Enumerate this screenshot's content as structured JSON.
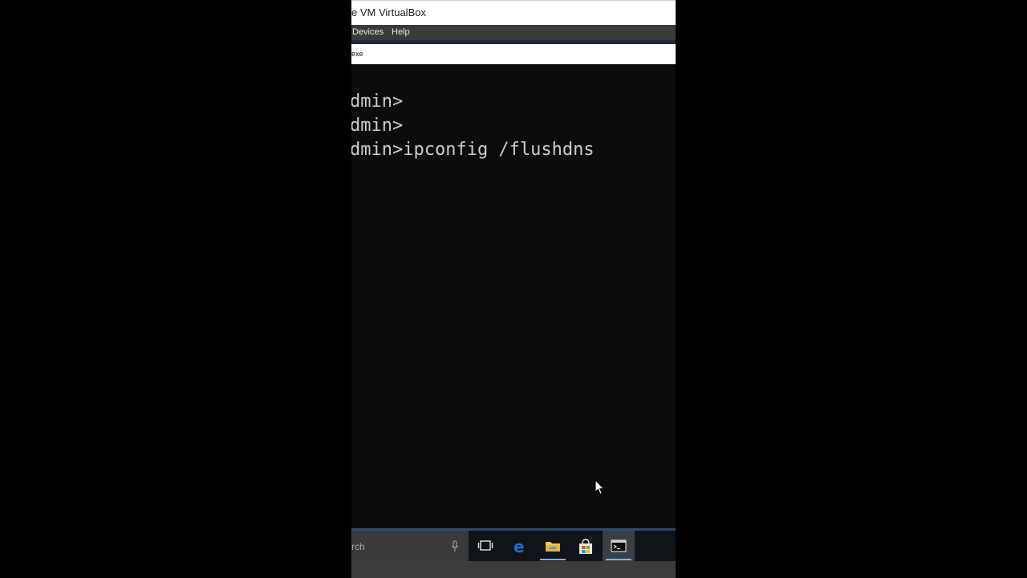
{
  "vbox": {
    "title": "e VM VirtualBox",
    "menu": [
      {
        "label": "Devices"
      },
      {
        "label": "Help"
      }
    ]
  },
  "cmd": {
    "title": "exe"
  },
  "console": {
    "lines": [
      "dmin>",
      "dmin>",
      "dmin>ipconfig /flushdns"
    ]
  },
  "taskbar": {
    "search_text": "rch",
    "icons": [
      {
        "name": "microphone-icon"
      },
      {
        "name": "task-view-icon"
      },
      {
        "name": "edge-icon"
      },
      {
        "name": "file-explorer-icon"
      },
      {
        "name": "store-icon"
      },
      {
        "name": "command-prompt-icon"
      }
    ]
  },
  "colors": {
    "console_bg": "#0c0c0c",
    "console_text": "#cccccc",
    "menubar_bg": "#3a3a3a",
    "taskbar_bg": "#101418",
    "taskbar_accent": "#7ab4e8",
    "edge_blue": "#1f6fd1",
    "folder_yellow": "#f2c94c"
  }
}
